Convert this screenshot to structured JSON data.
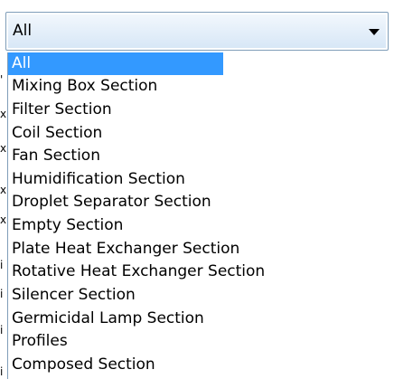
{
  "dropdown": {
    "selected_value": "All",
    "options": [
      "All",
      "Mixing Box Section",
      "Filter Section",
      "Coil Section",
      "Fan Section",
      "Humidification Section",
      "Droplet Separator Section",
      "Empty Section",
      "Plate Heat Exchanger Section",
      "Rotative Heat Exchanger Section",
      "Silencer Section",
      "Germicidal Lamp Section",
      "Profiles",
      "Composed Section"
    ],
    "highlighted_index": 0
  },
  "background_fragments": [
    "'",
    "x",
    "x",
    "x",
    "x",
    "i",
    "i",
    "i",
    "i"
  ],
  "icons": {
    "arrow": "chevron-down-icon"
  },
  "colors": {
    "highlight": "#3399ff",
    "border": "#7f9db9",
    "text": "#000000"
  }
}
